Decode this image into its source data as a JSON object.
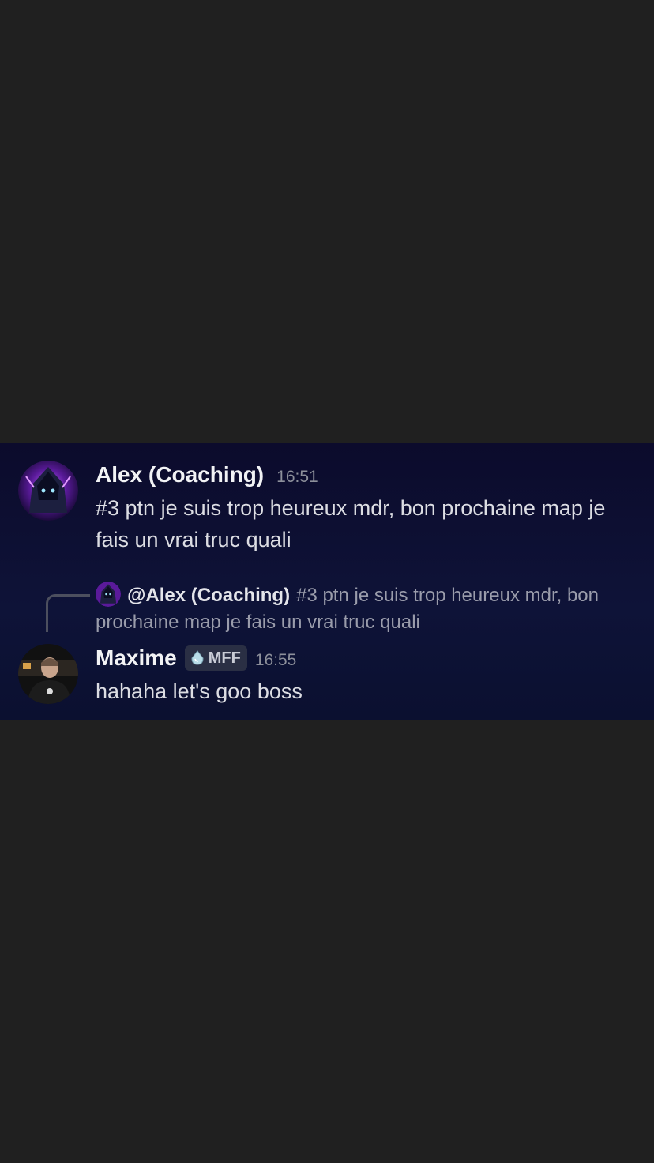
{
  "messages": [
    {
      "author": "Alex (Coaching)",
      "time": "16:51",
      "text": "#3 ptn je suis trop heureux mdr, bon prochaine map je fais un vrai truc quali"
    },
    {
      "reply": {
        "mention": "@Alex (Coaching)",
        "text": "#3 ptn je suis trop heureux mdr, bon prochaine map je fais un vrai truc quali"
      },
      "author": "Maxime",
      "tag": "MFF",
      "tag_icon": "diamond-gem-icon",
      "time": "16:55",
      "text": "hahaha let's goo boss"
    }
  ],
  "colors": {
    "page_background": "#202020",
    "panel_background": "#0d1033",
    "author": "#f2f3f5",
    "timestamp": "#8d909b",
    "message_text": "#dcdde3"
  }
}
